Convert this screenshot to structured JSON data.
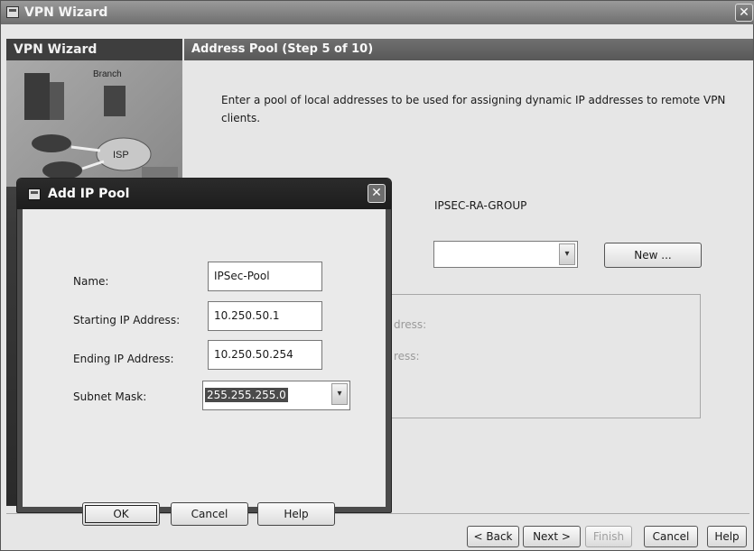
{
  "window": {
    "title": "VPN Wizard",
    "close_glyph": "✕"
  },
  "sidebar": {
    "title": "VPN Wizard",
    "art_labels": {
      "branch": "Branch",
      "isp": "ISP"
    }
  },
  "step": {
    "title": "Address Pool  (Step 5 of 10)"
  },
  "instructions": "Enter a pool of local addresses to be used for assigning dynamic IP addresses to remote VPN clients.",
  "tunnel_group": "IPSEC-RA-GROUP",
  "pool_select": {
    "value": "",
    "caret_glyph": "▾"
  },
  "new_button": "New ...",
  "info_labels": {
    "start": "dress:",
    "end": "ress:"
  },
  "footer": {
    "back": "< Back",
    "next": "Next >",
    "finish": "Finish",
    "cancel": "Cancel",
    "help": "Help"
  },
  "dialog": {
    "title": "Add IP Pool",
    "close_glyph": "✕",
    "fields": {
      "name_label": "Name:",
      "name_value": "IPSec-Pool",
      "start_label": "Starting IP Address:",
      "start_value": "10.250.50.1",
      "end_label": "Ending IP Address:",
      "end_value": "10.250.50.254",
      "mask_label": "Subnet Mask:",
      "mask_value": "255.255.255.0"
    },
    "buttons": {
      "ok": "OK",
      "cancel": "Cancel",
      "help": "Help"
    }
  },
  "colors": {
    "titlebar": "#6e6e6e",
    "dialog_titlebar": "#1d1d1d",
    "selection": "#4a4a4a"
  }
}
